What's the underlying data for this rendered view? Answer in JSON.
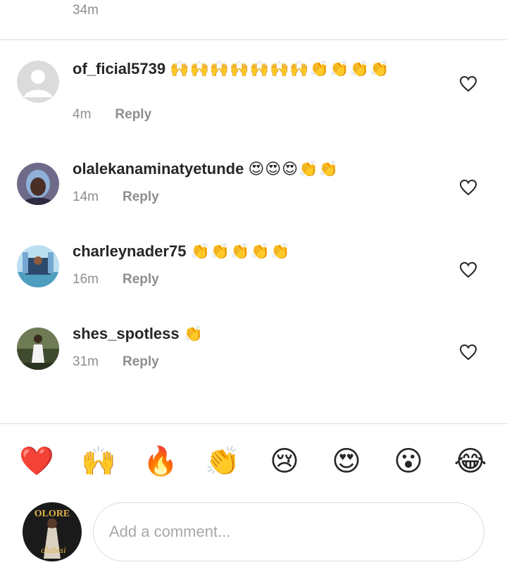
{
  "top": {
    "time": "34m"
  },
  "comments": [
    {
      "username": "of_ficial5739",
      "emojis": "🙌🙌🙌🙌🙌🙌🙌👏👏👏👏",
      "time": "4m",
      "reply": "Reply",
      "avatar": "default-avatar"
    },
    {
      "username": "olalekanaminatyetunde",
      "emojis": "😍😍😍👏👏",
      "time": "14m",
      "reply": "Reply",
      "avatar": "photo-avatar"
    },
    {
      "username": "charleynader75",
      "emojis": "👏👏👏👏👏",
      "time": "16m",
      "reply": "Reply",
      "avatar": "photo-avatar"
    },
    {
      "username": "shes_spotless",
      "emojis": "👏",
      "time": "31m",
      "reply": "Reply",
      "avatar": "photo-avatar"
    }
  ],
  "quick_emojis": [
    "❤️",
    "🙌",
    "🔥",
    "👏",
    "😢",
    "😍",
    "😮",
    "😂"
  ],
  "composer": {
    "placeholder": "Add a comment...",
    "avatar_text_top": "OLORE",
    "avatar_text_bottom": "olabisi"
  },
  "colors": {
    "secondary_text": "#8e8e8e",
    "divider": "#dbdbdb",
    "primary_text": "#262626"
  },
  "icons": {
    "like": "heart-outline-icon"
  }
}
